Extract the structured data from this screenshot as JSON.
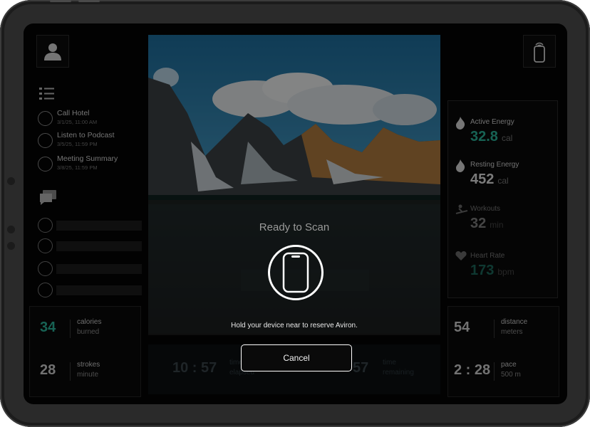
{
  "tasks": [
    {
      "title": "Call Hotel",
      "time": "3/1/25, 11:00 AM"
    },
    {
      "title": "Listen to Podcast",
      "time": "3/5/25, 11:59 PM"
    },
    {
      "title": "Meeting Summary",
      "time": "3/8/25, 11:59 PM"
    }
  ],
  "metrics": [
    {
      "label": "Active Energy",
      "value": "32.8",
      "unit": "cal",
      "color": "#2bb39a"
    },
    {
      "label": "Resting Energy",
      "value": "452",
      "unit": "cal",
      "color": "#e0e0e0"
    },
    {
      "label": "Workouts",
      "value": "32",
      "unit": "min",
      "color": "#e0e0e0"
    },
    {
      "label": "Heart Rate",
      "value": "173",
      "unit": "bpm",
      "color": "#2bb39a"
    }
  ],
  "stats_left": [
    {
      "value": "34",
      "line1": "calories",
      "line2": "burned",
      "color": "#2bb39a"
    },
    {
      "value": "28",
      "line1": "strokes",
      "line2": "minute",
      "color": "#cfcfcf"
    }
  ],
  "stats_right": [
    {
      "value": "54",
      "line1": "distance",
      "line2": "meters"
    },
    {
      "value": "2 : 28",
      "line1": "pace",
      "line2": "500 m"
    }
  ],
  "center_stats": {
    "elapsed_value": "10 : 57",
    "elapsed_line1": "time",
    "elapsed_line2": "elapsed",
    "remaining_value": "57",
    "remaining_line1": "time",
    "remaining_line2": "remaining"
  },
  "modal": {
    "title": "Ready to Scan",
    "hint": "Hold your device near to reserve Aviron.",
    "cancel_label": "Cancel"
  },
  "colors": {
    "accent": "#2bb39a",
    "background": "#050505",
    "frame": "#2a2a2a"
  }
}
